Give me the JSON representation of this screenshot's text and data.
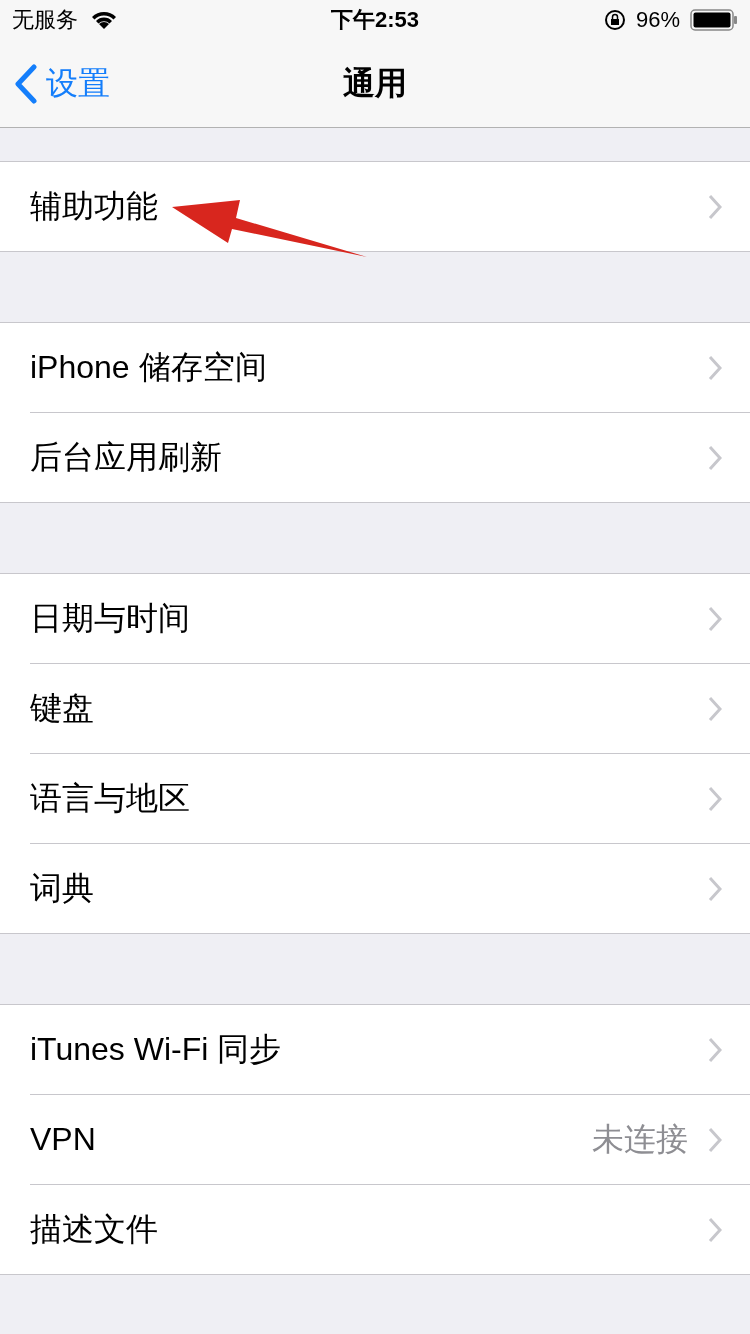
{
  "status_bar": {
    "carrier": "无服务",
    "time": "下午2:53",
    "battery": "96%"
  },
  "nav": {
    "back": "设置",
    "title": "通用"
  },
  "sections": [
    {
      "rows": [
        {
          "label": "辅助功能"
        }
      ]
    },
    {
      "rows": [
        {
          "label": "iPhone 储存空间"
        },
        {
          "label": "后台应用刷新"
        }
      ]
    },
    {
      "rows": [
        {
          "label": "日期与时间"
        },
        {
          "label": "键盘"
        },
        {
          "label": "语言与地区"
        },
        {
          "label": "词典"
        }
      ]
    },
    {
      "rows": [
        {
          "label": "iTunes Wi-Fi 同步"
        },
        {
          "label": "VPN",
          "detail": "未连接"
        },
        {
          "label": "描述文件"
        }
      ]
    }
  ]
}
